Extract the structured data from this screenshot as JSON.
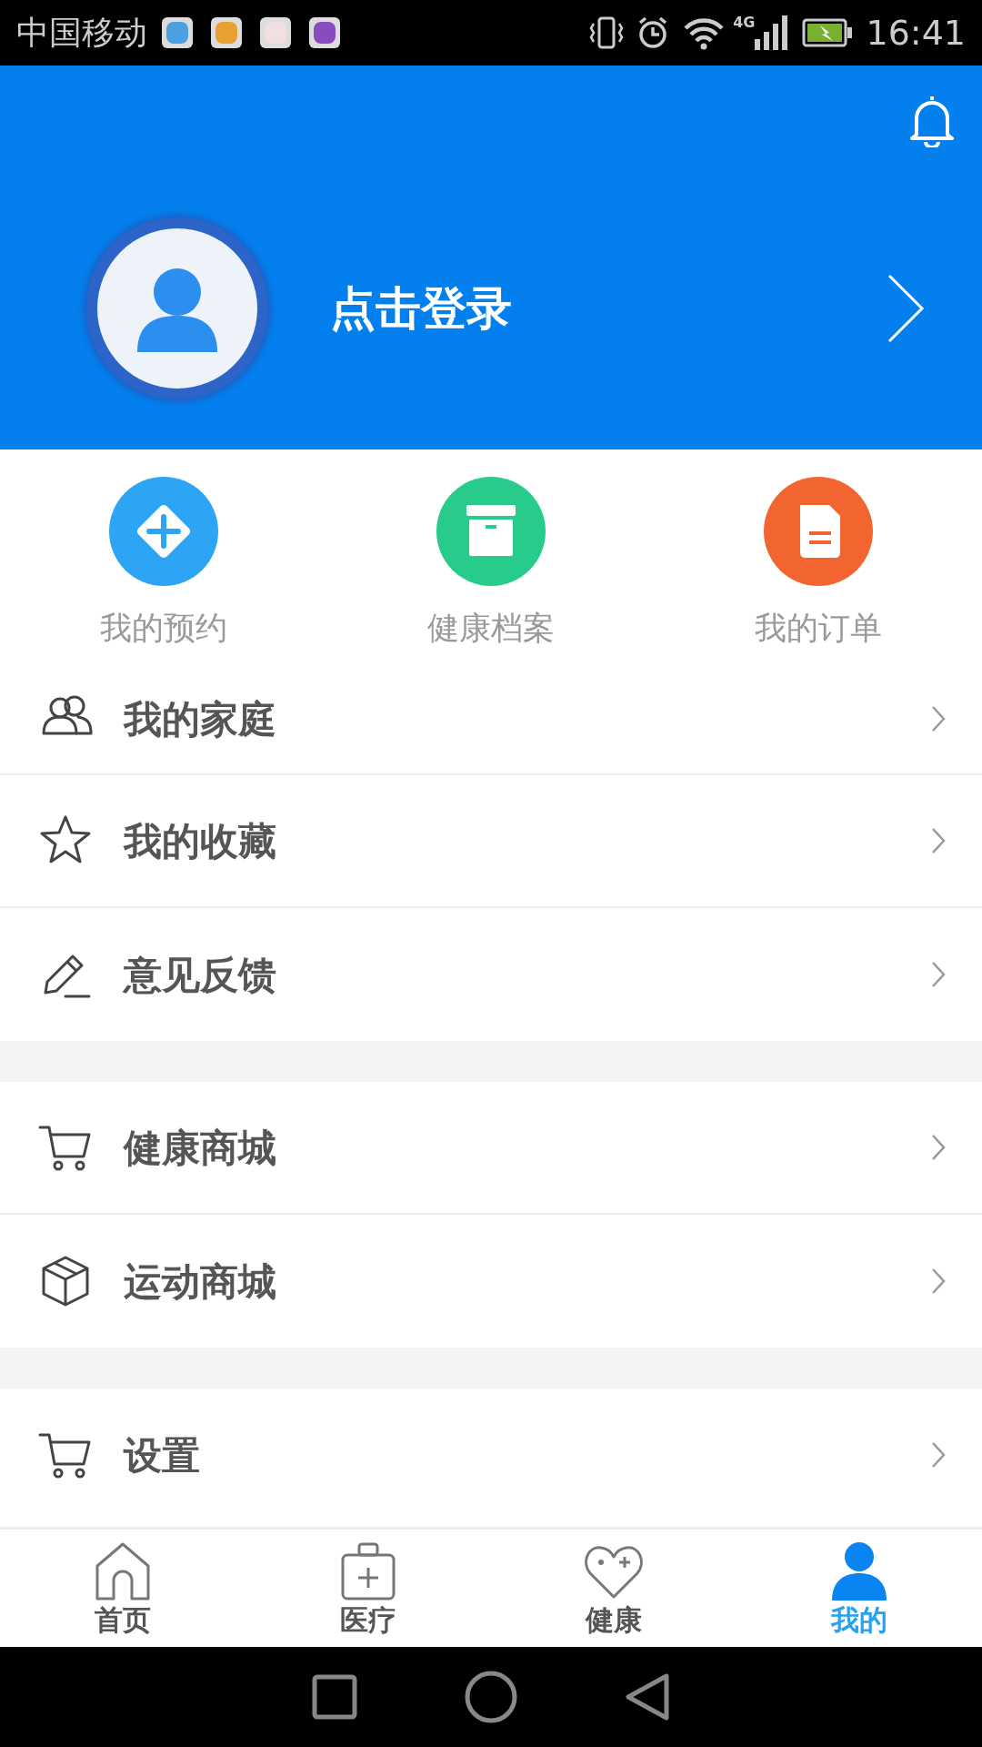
{
  "status_bar": {
    "carrier": "中国移动",
    "network": "4G",
    "time": "16:41"
  },
  "header": {
    "login_text": "点击登录"
  },
  "shortcuts": [
    {
      "label": "我的预约"
    },
    {
      "label": "健康档案"
    },
    {
      "label": "我的订单"
    }
  ],
  "menu_groups": [
    [
      {
        "label": "我的家庭"
      },
      {
        "label": "我的收藏"
      },
      {
        "label": "意见反馈"
      }
    ],
    [
      {
        "label": "健康商城"
      },
      {
        "label": "运动商城"
      }
    ],
    [
      {
        "label": "设置"
      }
    ]
  ],
  "tabs": [
    {
      "label": "首页",
      "selected": false
    },
    {
      "label": "医疗",
      "selected": false
    },
    {
      "label": "健康",
      "selected": false
    },
    {
      "label": "我的",
      "selected": true
    }
  ]
}
